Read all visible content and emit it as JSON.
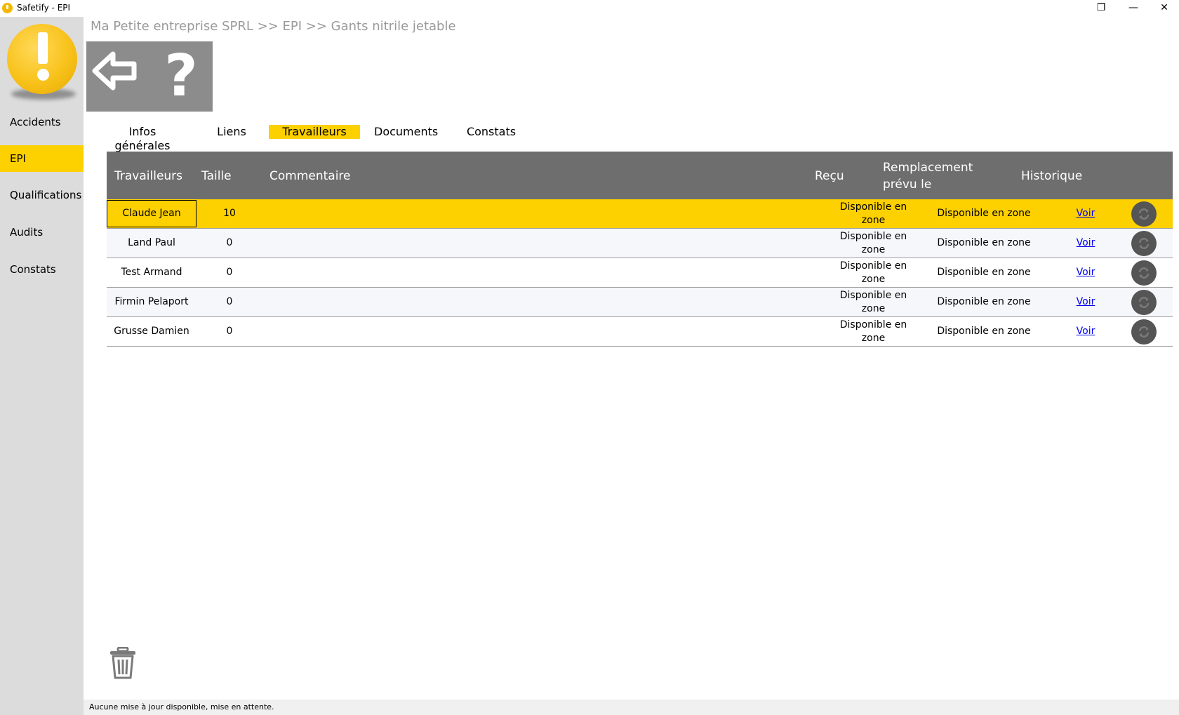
{
  "window": {
    "title": "Safetify - EPI",
    "minimize_glyph": "—",
    "restore_glyph": "❐",
    "close_glyph": "✕"
  },
  "sidebar": {
    "items": [
      {
        "label": "Accidents"
      },
      {
        "label": "EPI",
        "active": true
      },
      {
        "label": "Qualifications"
      },
      {
        "label": "Audits"
      },
      {
        "label": "Constats"
      }
    ]
  },
  "breadcrumb": "Ma Petite entreprise SPRL >> EPI >> Gants nitrile jetable",
  "toolbar": {
    "back_icon": "back-arrow-icon",
    "help_glyph": "?"
  },
  "tabs": [
    {
      "label": "Infos générales"
    },
    {
      "label": "Liens"
    },
    {
      "label": "Travailleurs",
      "active": true
    },
    {
      "label": "Documents"
    },
    {
      "label": "Constats"
    }
  ],
  "table": {
    "headers": {
      "workers": "Travailleurs",
      "size": "Taille",
      "comment": "Commentaire",
      "received": "Reçu",
      "replacement_line1": "Remplacement",
      "replacement_line2": "prévu le",
      "history": "Historique"
    },
    "rows": [
      {
        "name": "Claude Jean",
        "size": "10",
        "comment": "",
        "received_line1": "Disponible en",
        "received_line2": "zone",
        "replacement": "Disponible en zone",
        "history": "Voir",
        "selected": true
      },
      {
        "name": "Land Paul",
        "size": "0",
        "comment": "",
        "received_line1": "Disponible en",
        "received_line2": "zone",
        "replacement": "Disponible en zone",
        "history": "Voir"
      },
      {
        "name": "Test Armand",
        "size": "0",
        "comment": "",
        "received_line1": "Disponible en",
        "received_line2": "zone",
        "replacement": "Disponible en zone",
        "history": "Voir"
      },
      {
        "name": "Firmin Pelaport",
        "size": "0",
        "comment": "",
        "received_line1": "Disponible en",
        "received_line2": "zone",
        "replacement": "Disponible en zone",
        "history": "Voir"
      },
      {
        "name": "Grusse Damien",
        "size": "0",
        "comment": "",
        "received_line1": "Disponible en",
        "received_line2": "zone",
        "replacement": "Disponible en zone",
        "history": "Voir"
      }
    ]
  },
  "status": "Aucune mise à jour disponible, mise en attente.",
  "colors": {
    "accent": "#fdd000",
    "sidebar_bg": "#dcdcdc",
    "header_bg": "#6e6e6e",
    "toolbar_bg": "#8c8c8c"
  }
}
